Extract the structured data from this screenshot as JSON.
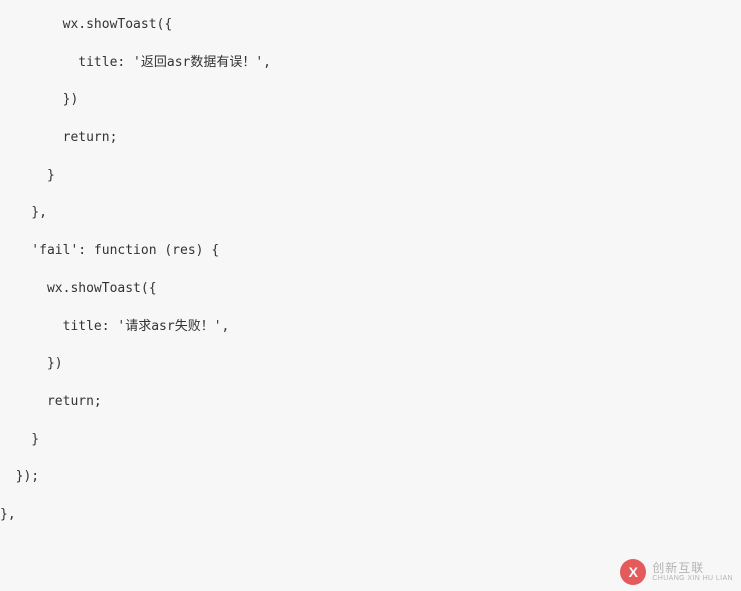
{
  "code": {
    "lines": [
      "        wx.showToast({",
      "",
      "          title: '返回asr数据有误！',",
      "",
      "        })",
      "",
      "        return;",
      "",
      "      }",
      "",
      "    },",
      "",
      "    'fail': function (res) {",
      "",
      "      wx.showToast({",
      "",
      "        title: '请求asr失败！',",
      "",
      "      })",
      "",
      "      return;",
      "",
      "    }",
      "",
      "  });",
      "",
      "},"
    ]
  },
  "watermark": {
    "icon_letter": "X",
    "line1": "创新互联",
    "line2": "CHUANG XIN HU LIAN"
  }
}
